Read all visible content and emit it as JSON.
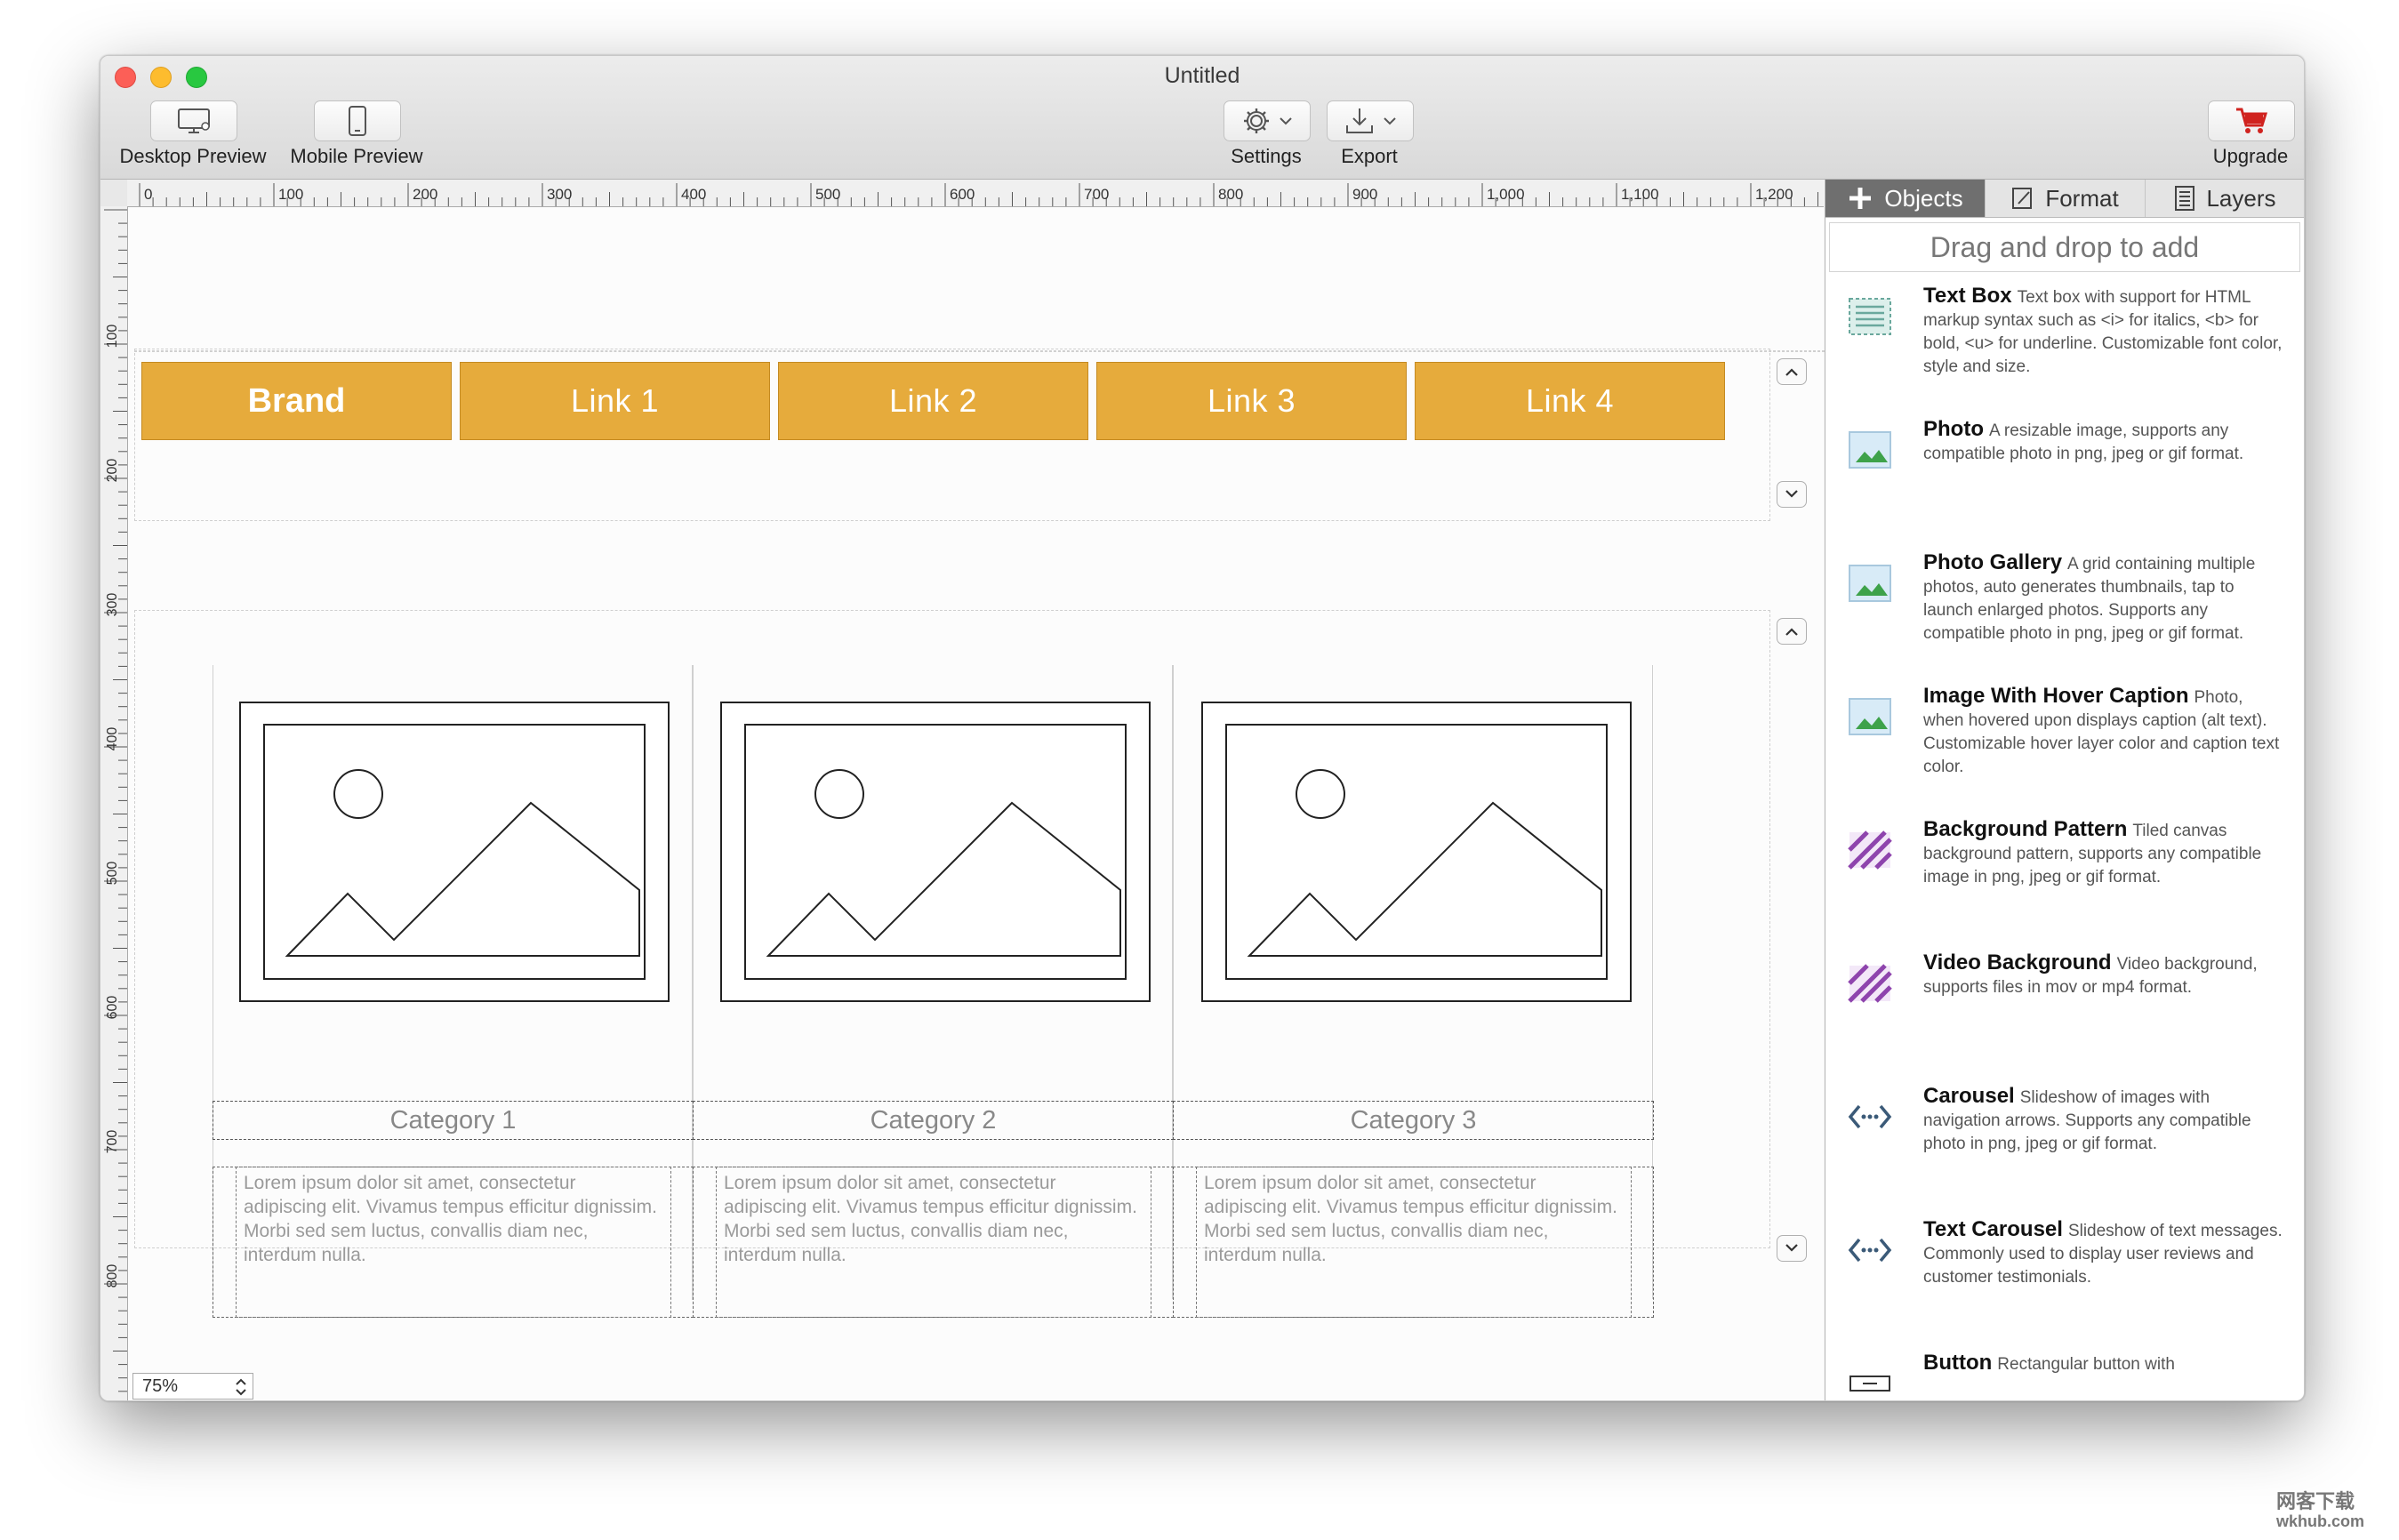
{
  "window": {
    "title": "Untitled"
  },
  "toolbar": {
    "desktop_preview": "Desktop Preview",
    "mobile_preview": "Mobile Preview",
    "settings": "Settings",
    "export": "Export",
    "upgrade": "Upgrade"
  },
  "ruler": {
    "top_labels": [
      "0",
      "100",
      "200",
      "300",
      "400",
      "500",
      "600",
      "700",
      "800",
      "900",
      "1,000",
      "1,100",
      "1,200"
    ],
    "left_labels": [
      "100",
      "200",
      "300",
      "400",
      "500",
      "600",
      "700",
      "800"
    ]
  },
  "nav": {
    "brand": "Brand",
    "links": [
      "Link 1",
      "Link 2",
      "Link 3",
      "Link 4"
    ]
  },
  "columns": [
    {
      "category": "Category 1",
      "text": "Lorem ipsum dolor sit amet, consectetur adipiscing elit. Vivamus tempus efficitur dignissim. Morbi sed sem luctus, convallis diam nec, interdum nulla."
    },
    {
      "category": "Category 2",
      "text": "Lorem ipsum dolor sit amet, consectetur adipiscing elit. Vivamus tempus efficitur dignissim. Morbi sed sem luctus, convallis diam nec, interdum nulla."
    },
    {
      "category": "Category 3",
      "text": "Lorem ipsum dolor sit amet, consectetur adipiscing elit. Vivamus tempus efficitur dignissim. Morbi sed sem luctus, convallis diam nec, interdum nulla."
    }
  ],
  "zoom": {
    "value": "75%"
  },
  "panel": {
    "tabs": [
      "Objects",
      "Format",
      "Layers"
    ],
    "drag_hint": "Drag and drop to add",
    "items": [
      {
        "title": "Text Box",
        "desc": "Text box with support for HTML markup syntax such as <i> for italics, <b> for bold, <u> for underline. Customizable font color, style and size.",
        "icon": "text-box-icon"
      },
      {
        "title": "Photo",
        "desc": "A resizable image, supports any compatible photo in png, jpeg or gif format.",
        "icon": "photo-icon"
      },
      {
        "title": "Photo Gallery",
        "desc": "A grid containing multiple photos, auto generates thumbnails, tap to launch enlarged photos. Supports any compatible photo in png, jpeg or gif format.",
        "icon": "photo-gallery-icon"
      },
      {
        "title": "Image With Hover Caption",
        "desc": "Photo, when hovered upon displays caption (alt text). Customizable hover layer color and caption text color.",
        "icon": "hover-caption-icon"
      },
      {
        "title": "Background Pattern",
        "desc": "Tiled canvas background pattern, supports any compatible image in png, jpeg or gif format.",
        "icon": "background-pattern-icon"
      },
      {
        "title": "Video Background",
        "desc": "Video background, supports files in mov or mp4 format.",
        "icon": "video-background-icon"
      },
      {
        "title": "Carousel",
        "desc": "Slideshow of images with navigation arrows.  Supports any compatible photo in png, jpeg or gif format.",
        "icon": "carousel-icon"
      },
      {
        "title": "Text Carousel",
        "desc": "Slideshow of text messages.  Commonly used to display user reviews and customer testimonials.",
        "icon": "text-carousel-icon"
      },
      {
        "title": "Button",
        "desc": "Rectangular button with",
        "icon": "button-icon"
      }
    ]
  },
  "watermark": {
    "line1": "网客下载",
    "line2": "wkhub.com"
  },
  "colors": {
    "nav_orange": "#e6ab3c",
    "tab_active": "#6f6f6f",
    "pattern_purple": "#8e44ad"
  }
}
